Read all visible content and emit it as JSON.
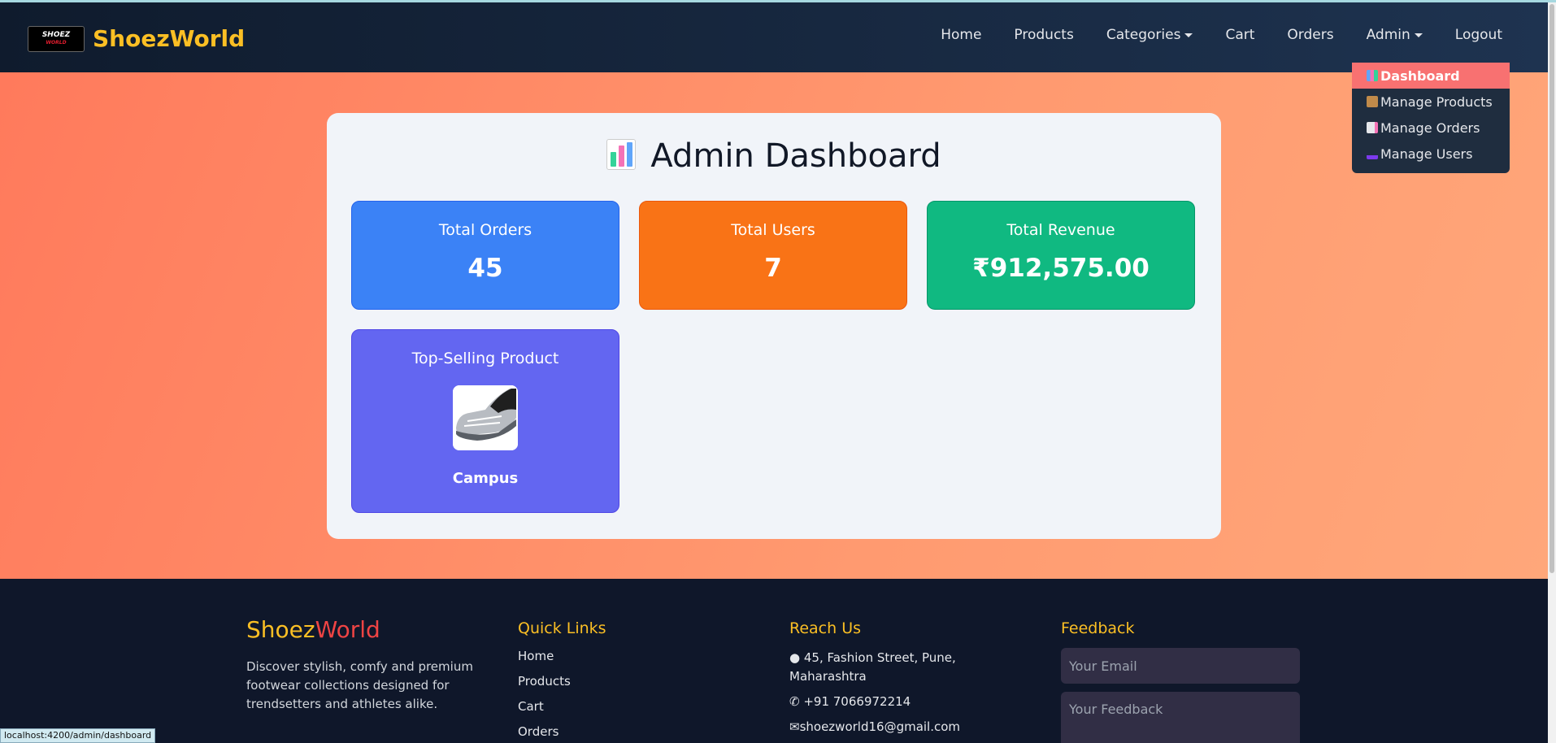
{
  "brand": {
    "logo_text_top": "SHOEZ",
    "logo_text_bottom": "WORLD",
    "name": "ShoezWorld"
  },
  "nav": {
    "home": "Home",
    "products": "Products",
    "categories": "Categories",
    "cart": "Cart",
    "orders": "Orders",
    "admin": "Admin",
    "logout": "Logout"
  },
  "admin_menu": [
    {
      "label": "Dashboard",
      "icon": "bar-chart-icon",
      "active": true
    },
    {
      "label": "Manage Products",
      "icon": "package-icon"
    },
    {
      "label": "Manage Orders",
      "icon": "document-icon"
    },
    {
      "label": "Manage Users",
      "icon": "users-icon"
    }
  ],
  "dashboard": {
    "title": "Admin Dashboard",
    "stats": {
      "orders": {
        "label": "Total Orders",
        "value": "45"
      },
      "users": {
        "label": "Total Users",
        "value": "7"
      },
      "revenue": {
        "label": "Total Revenue",
        "value": "₹912,575.00"
      }
    },
    "top_product": {
      "label": "Top-Selling Product",
      "name": "Campus"
    }
  },
  "footer": {
    "brand_first": "Shoez",
    "brand_second": "World",
    "description": "Discover stylish, comfy and premium footwear collections designed for trendsetters and athletes alike.",
    "quick_links_title": "Quick Links",
    "quick_links": [
      "Home",
      "Products",
      "Cart",
      "Orders"
    ],
    "reach_title": "Reach Us",
    "address": "45, Fashion Street, Pune, Maharashtra",
    "phone": "+91 7066972214",
    "email": "shoezworld16@gmail.com",
    "feedback_title": "Feedback",
    "email_placeholder": "Your Email",
    "feedback_placeholder": "Your Feedback"
  },
  "status_url": "localhost:4200/admin/dashboard",
  "colors": {
    "accent": "#fbbf24",
    "orders_card": "#3b82f6",
    "users_card": "#f97316",
    "revenue_card": "#10b981",
    "top_card": "#6366f1",
    "menu_active": "#f87171"
  }
}
